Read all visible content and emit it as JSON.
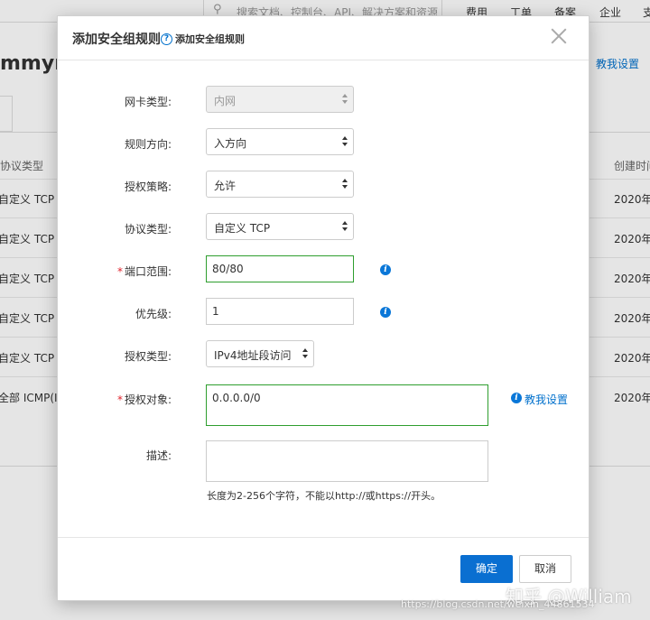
{
  "background": {
    "search_placeholder": "搜索文档、控制台、API、解决方案和资源",
    "nav": [
      "费用",
      "工单",
      "备案",
      "企业",
      "支"
    ],
    "page_title": "mmyru",
    "help_link": "教我设置",
    "table_headers": [
      "协议类型",
      "创建时间"
    ],
    "rows": [
      {
        "protocol": "自定义 TCP",
        "created": "2020年"
      },
      {
        "protocol": "自定义 TCP",
        "created": "2020年"
      },
      {
        "protocol": "自定义 TCP",
        "created": "2020年"
      },
      {
        "protocol": "自定义 TCP",
        "created": "2020年"
      },
      {
        "protocol": "自定义 TCP",
        "created": "2020年"
      },
      {
        "protocol": "全部 ICMP(IP",
        "created": "2020年"
      }
    ]
  },
  "dialog": {
    "title": "添加安全组规则",
    "help_link": "添加安全组规则",
    "fields": {
      "nic_type": {
        "label": "网卡类型:",
        "value": "内网"
      },
      "direction": {
        "label": "规则方向:",
        "value": "入方向"
      },
      "policy": {
        "label": "授权策略:",
        "value": "允许"
      },
      "protocol": {
        "label": "协议类型:",
        "value": "自定义 TCP"
      },
      "port_range": {
        "label": "端口范围:",
        "value": "80/80"
      },
      "priority": {
        "label": "优先级:",
        "value": "1"
      },
      "auth_type": {
        "label": "授权类型:",
        "value": "IPv4地址段访问"
      },
      "auth_object": {
        "label": "授权对象:",
        "value": "0.0.0.0/0",
        "help_link": "教我设置"
      },
      "description": {
        "label": "描述:",
        "value": "",
        "hint": "长度为2-256个字符，不能以http://或https://开头。"
      }
    },
    "buttons": {
      "confirm": "确定",
      "cancel": "取消"
    }
  },
  "watermark": {
    "brand": "知乎 @William",
    "url": "https://blog.csdn.net/weixin_44861534"
  },
  "colors": {
    "accent": "#0a6fd1",
    "valid_border": "#2e9e2e",
    "required": "#e0232d"
  }
}
